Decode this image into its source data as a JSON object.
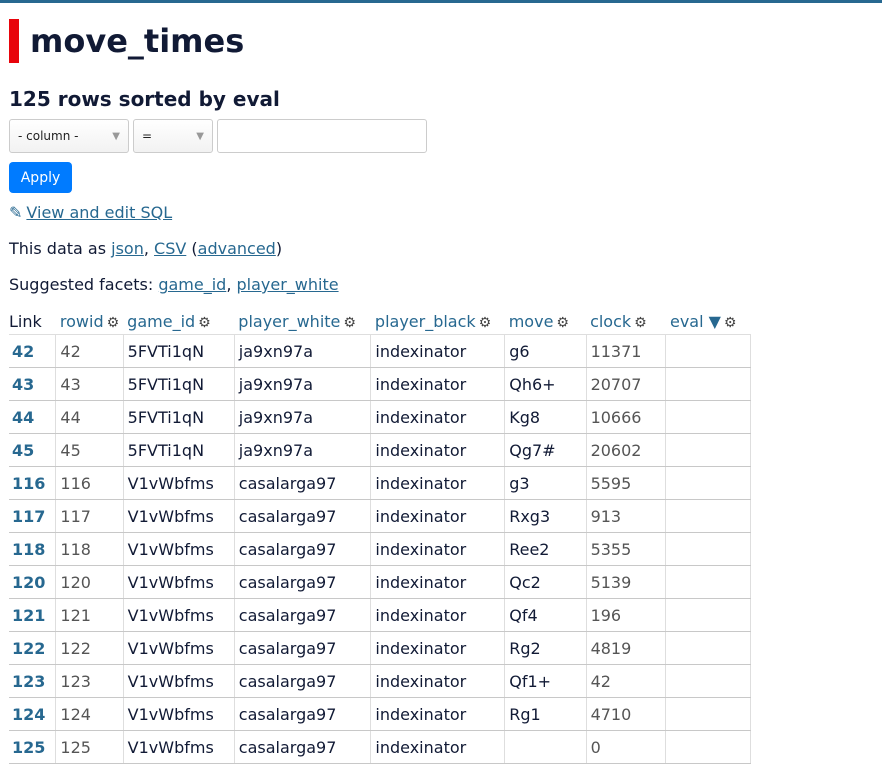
{
  "title": "move_times",
  "subtitle": "125 rows sorted by eval",
  "filters": {
    "column_placeholder": "- column -",
    "operator": "=",
    "apply_label": "Apply"
  },
  "sql_link": "View and edit SQL",
  "export": {
    "prefix": "This data as ",
    "json": "json",
    "sep1": ", ",
    "csv": "CSV",
    "open": " (",
    "advanced": "advanced",
    "close": ")"
  },
  "facets": {
    "label": "Suggested facets: ",
    "items": [
      "game_id",
      "player_white"
    ],
    "sep": ", "
  },
  "columns": [
    "Link",
    "rowid",
    "game_id",
    "player_white",
    "player_black",
    "move",
    "clock",
    "eval ▼"
  ],
  "rows": [
    {
      "link": "42",
      "rowid": "42",
      "game_id": "5FVTi1qN",
      "player_white": "ja9xn97a",
      "player_black": "indexinator",
      "move": "g6",
      "clock": "11371",
      "eval": ""
    },
    {
      "link": "43",
      "rowid": "43",
      "game_id": "5FVTi1qN",
      "player_white": "ja9xn97a",
      "player_black": "indexinator",
      "move": "Qh6+",
      "clock": "20707",
      "eval": ""
    },
    {
      "link": "44",
      "rowid": "44",
      "game_id": "5FVTi1qN",
      "player_white": "ja9xn97a",
      "player_black": "indexinator",
      "move": "Kg8",
      "clock": "10666",
      "eval": ""
    },
    {
      "link": "45",
      "rowid": "45",
      "game_id": "5FVTi1qN",
      "player_white": "ja9xn97a",
      "player_black": "indexinator",
      "move": "Qg7#",
      "clock": "20602",
      "eval": ""
    },
    {
      "link": "116",
      "rowid": "116",
      "game_id": "V1vWbfms",
      "player_white": "casalarga97",
      "player_black": "indexinator",
      "move": "g3",
      "clock": "5595",
      "eval": ""
    },
    {
      "link": "117",
      "rowid": "117",
      "game_id": "V1vWbfms",
      "player_white": "casalarga97",
      "player_black": "indexinator",
      "move": "Rxg3",
      "clock": "913",
      "eval": ""
    },
    {
      "link": "118",
      "rowid": "118",
      "game_id": "V1vWbfms",
      "player_white": "casalarga97",
      "player_black": "indexinator",
      "move": "Ree2",
      "clock": "5355",
      "eval": ""
    },
    {
      "link": "120",
      "rowid": "120",
      "game_id": "V1vWbfms",
      "player_white": "casalarga97",
      "player_black": "indexinator",
      "move": "Qc2",
      "clock": "5139",
      "eval": ""
    },
    {
      "link": "121",
      "rowid": "121",
      "game_id": "V1vWbfms",
      "player_white": "casalarga97",
      "player_black": "indexinator",
      "move": "Qf4",
      "clock": "196",
      "eval": ""
    },
    {
      "link": "122",
      "rowid": "122",
      "game_id": "V1vWbfms",
      "player_white": "casalarga97",
      "player_black": "indexinator",
      "move": "Rg2",
      "clock": "4819",
      "eval": ""
    },
    {
      "link": "123",
      "rowid": "123",
      "game_id": "V1vWbfms",
      "player_white": "casalarga97",
      "player_black": "indexinator",
      "move": "Qf1+",
      "clock": "42",
      "eval": ""
    },
    {
      "link": "124",
      "rowid": "124",
      "game_id": "V1vWbfms",
      "player_white": "casalarga97",
      "player_black": "indexinator",
      "move": "Rg1",
      "clock": "4710",
      "eval": ""
    },
    {
      "link": "125",
      "rowid": "125",
      "game_id": "V1vWbfms",
      "player_white": "casalarga97",
      "player_black": "indexinator",
      "move": "",
      "clock": "0",
      "eval": ""
    }
  ],
  "icons": {
    "gear": "gear-icon",
    "sort_desc": "sort-desc-icon",
    "pencil": "pencil-icon",
    "dropdown": "chevron-down-icon"
  },
  "colors": {
    "accent_bar": "#e8040b",
    "link": "#276890",
    "button": "#007bff",
    "top_border": "#276890"
  }
}
